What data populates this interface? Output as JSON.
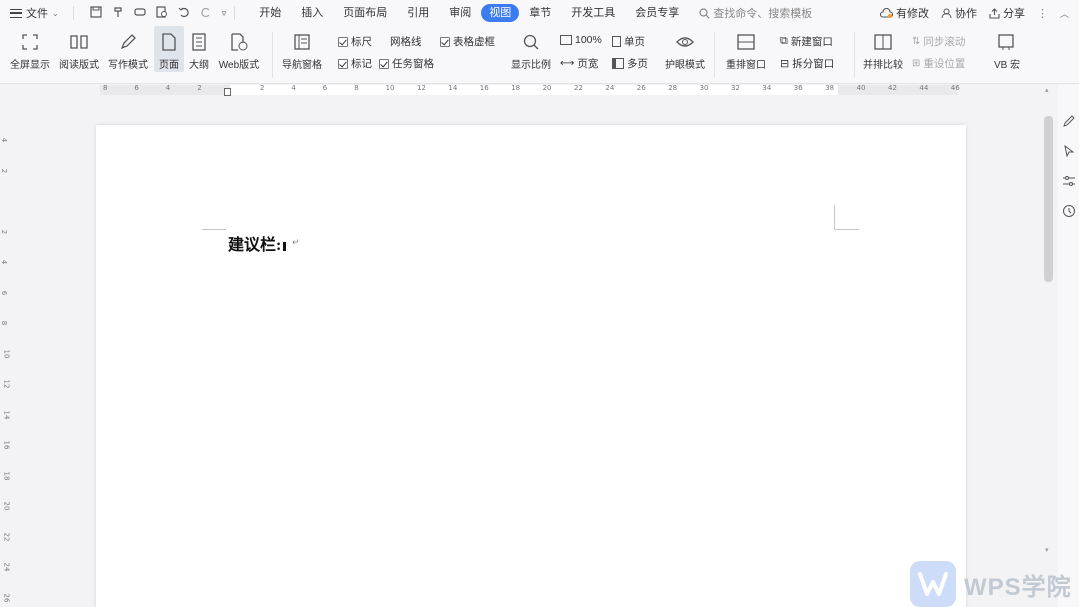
{
  "menubar": {
    "file_label": "文件",
    "tabs": [
      "开始",
      "插入",
      "页面布局",
      "引用",
      "审阅",
      "视图",
      "章节",
      "开发工具",
      "会员专享"
    ],
    "active_tab": "视图",
    "search_placeholder": "查找命令、搜索模板",
    "right": {
      "changes": "有修改",
      "collab": "协作",
      "share": "分享"
    }
  },
  "ribbon": {
    "fullscreen": "全屏显示",
    "reading": "阅读版式",
    "writing": "写作模式",
    "page": "页面",
    "outline": "大纲",
    "web": "Web版式",
    "nav_pane": "导航窗格",
    "ruler": "标尺",
    "gridlines": "网格线",
    "table_borders": "表格虚框",
    "marks": "标记",
    "task_pane": "任务窗格",
    "zoom": "显示比例",
    "zoom_100": "100%",
    "page_width": "页宽",
    "single_page": "单页",
    "multi_page": "多页",
    "eye_mode": "护眼模式",
    "rearrange": "重排窗口",
    "new_window": "新建窗口",
    "split_window": "拆分窗口",
    "side_by_side": "并排比较",
    "sync_scroll": "同步滚动",
    "reset_pos": "重设位置",
    "vba": "VB 宏"
  },
  "ruler": {
    "h_ticks": [
      "8",
      "6",
      "4",
      "2",
      "",
      "2",
      "4",
      "6",
      "8",
      "10",
      "12",
      "14",
      "16",
      "18",
      "20",
      "22",
      "24",
      "26",
      "28",
      "30",
      "32",
      "34",
      "36",
      "38",
      "40",
      "42",
      "44",
      "46"
    ],
    "v_ticks": [
      "4",
      "2",
      "",
      "2",
      "4",
      "6",
      "8",
      "10",
      "12",
      "14",
      "16",
      "18",
      "20",
      "22",
      "24",
      "26"
    ]
  },
  "document": {
    "text": "建议栏:",
    "para_mark": "↵"
  },
  "watermark": {
    "text": "WPS学院"
  },
  "colors": {
    "accent": "#3d7bf0"
  }
}
